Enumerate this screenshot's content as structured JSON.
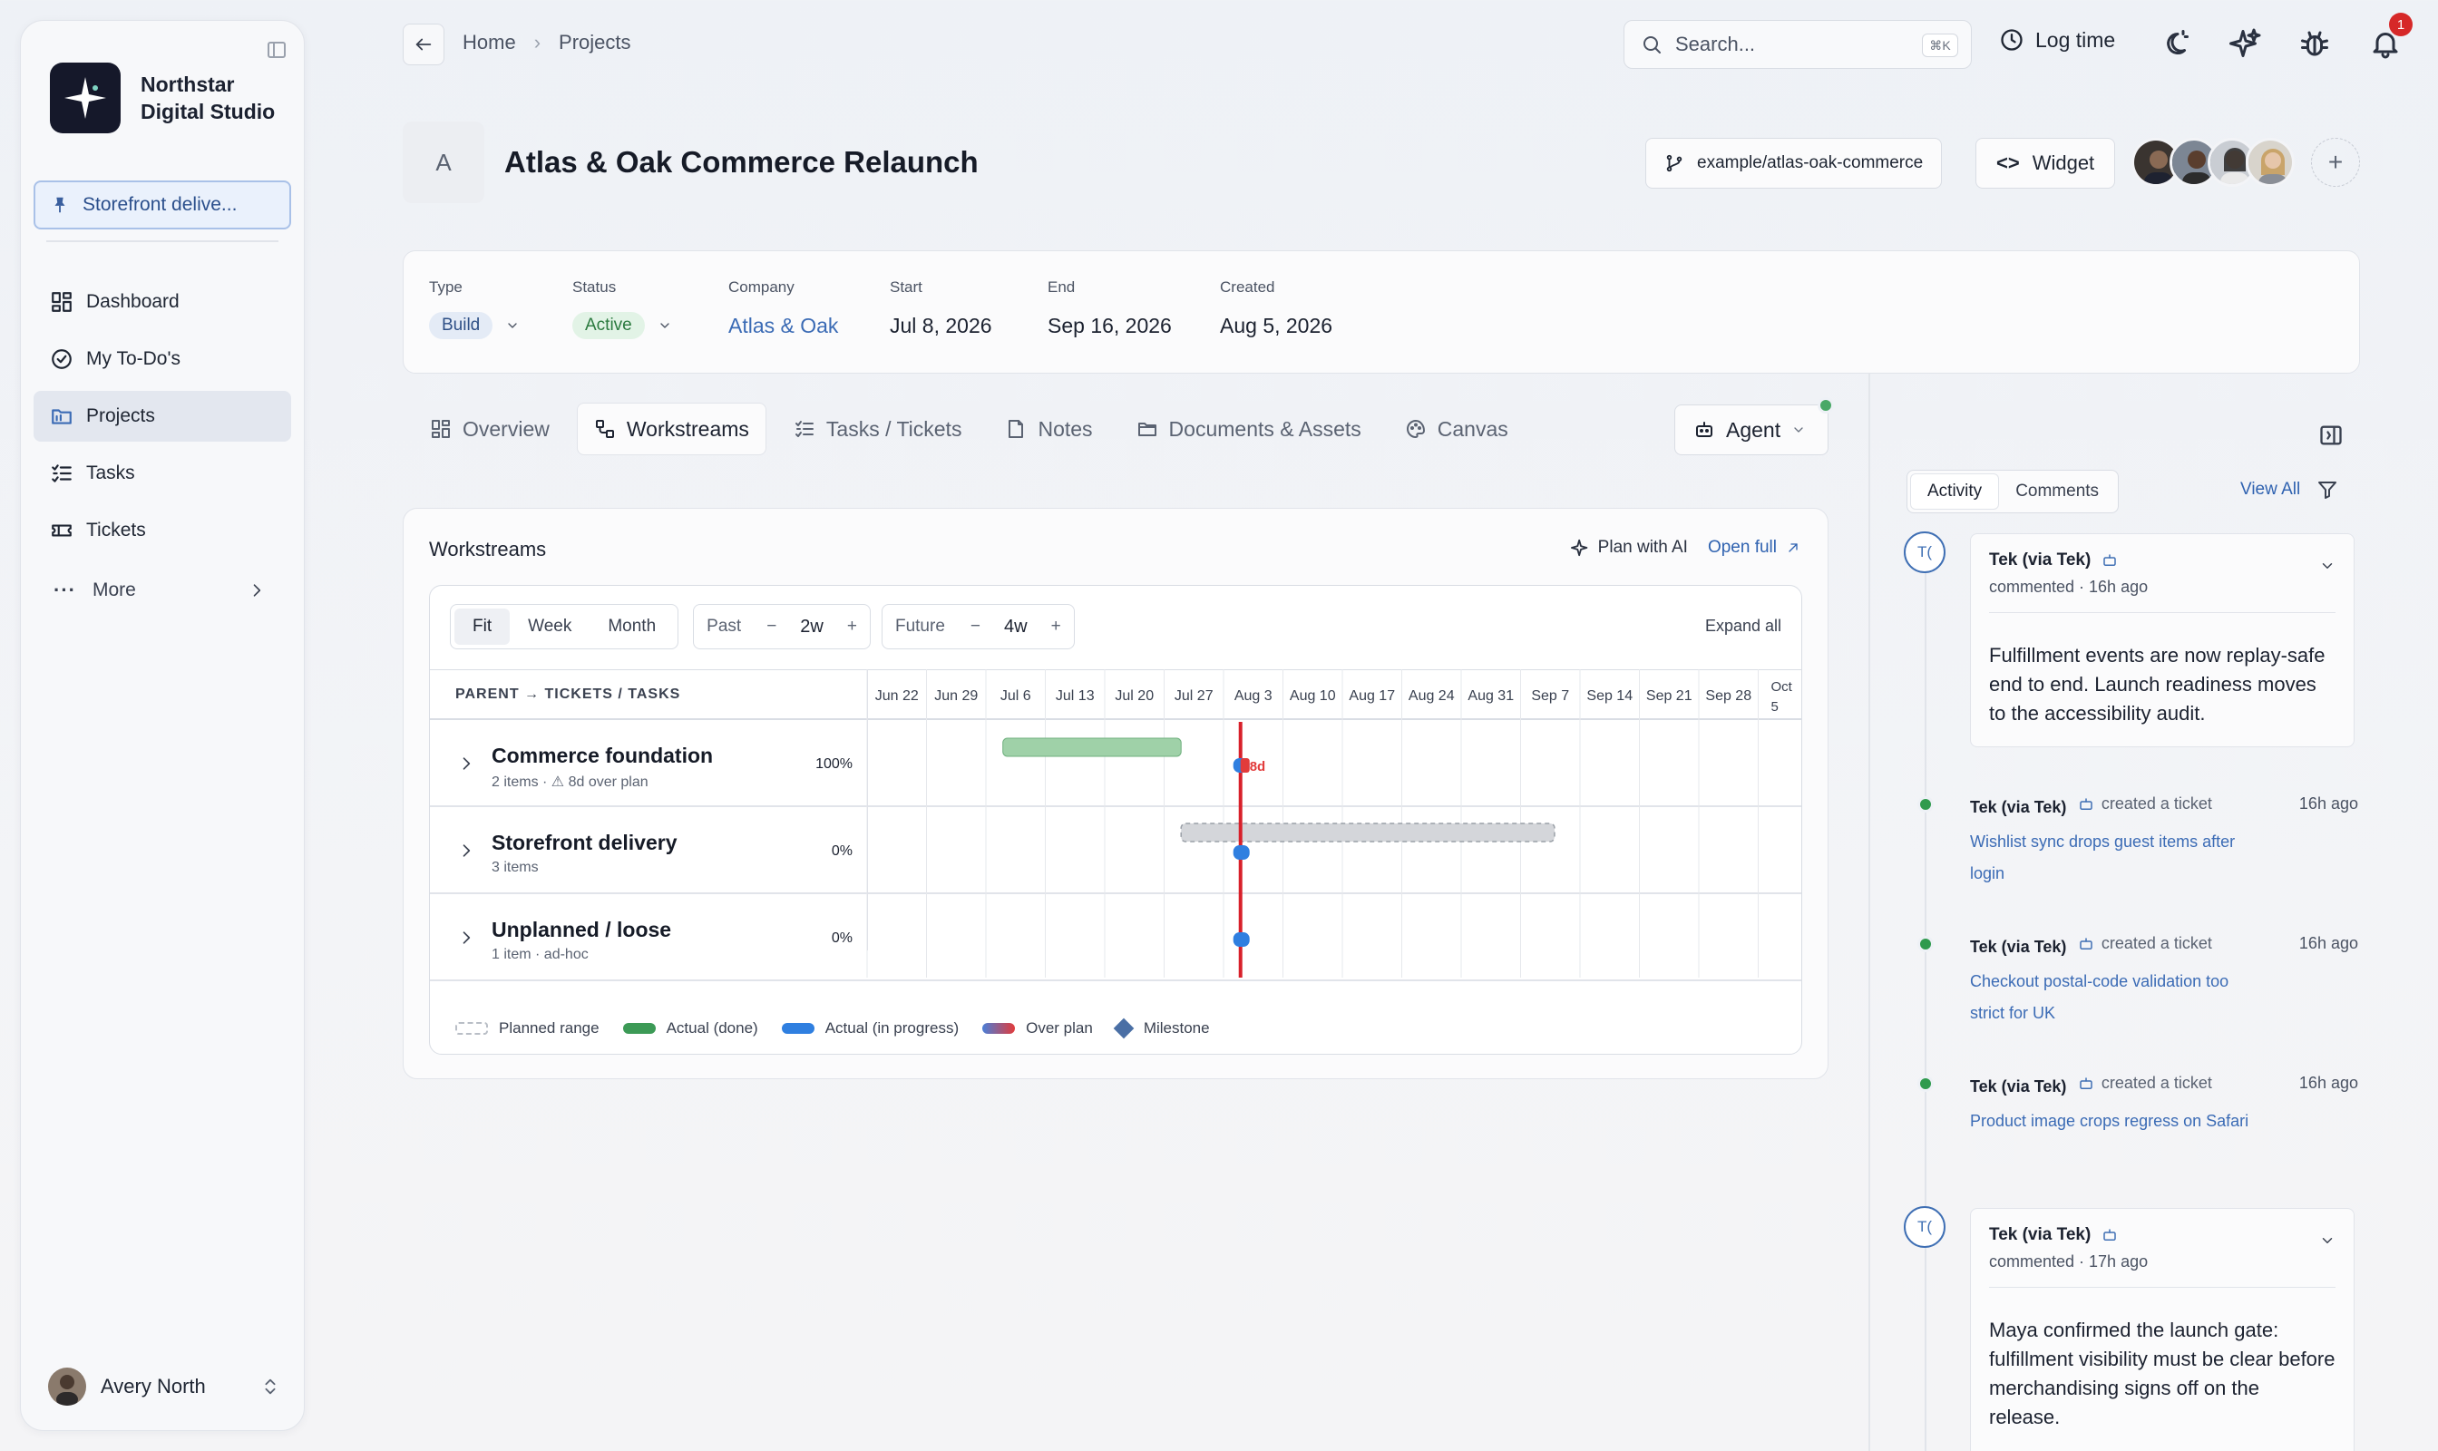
{
  "sidebar": {
    "org_name_line1": "Northstar",
    "org_name_line2": "Digital Studio",
    "pinned": "Storefront delive...",
    "nav": [
      {
        "label": "Dashboard",
        "icon": "dashboard-icon"
      },
      {
        "label": "My To-Do's",
        "icon": "check-circle-icon"
      },
      {
        "label": "Projects",
        "icon": "folder-icon",
        "active": true
      },
      {
        "label": "Tasks",
        "icon": "task-list-icon"
      },
      {
        "label": "Tickets",
        "icon": "ticket-icon"
      }
    ],
    "more": "More",
    "user": "Avery North"
  },
  "topbar": {
    "breadcrumb": [
      "Home",
      "Projects"
    ],
    "search_placeholder": "Search...",
    "shortcut": "⌘K",
    "log_time": "Log time",
    "notification_count": "1"
  },
  "project": {
    "avatar_letter": "A",
    "title": "Atlas & Oak Commerce Relaunch",
    "repo": "example/atlas-oak-commerce",
    "widget": "Widget",
    "meta": {
      "type_label": "Type",
      "type": "Build",
      "status_label": "Status",
      "status": "Active",
      "company_label": "Company",
      "company": "Atlas & Oak",
      "start_label": "Start",
      "start": "Jul 8, 2026",
      "end_label": "End",
      "end": "Sep 16, 2026",
      "created_label": "Created",
      "created": "Aug 5, 2026"
    }
  },
  "tabs": [
    "Overview",
    "Workstreams",
    "Tasks / Tickets",
    "Notes",
    "Documents & Assets",
    "Canvas"
  ],
  "active_tab": "Workstreams",
  "agent": "Agent",
  "workstreams": {
    "title": "Workstreams",
    "plan_ai": "Plan with AI",
    "open_full": "Open full",
    "zoom": [
      "Fit",
      "Week",
      "Month"
    ],
    "past_label": "Past",
    "past_value": "2w",
    "future_label": "Future",
    "future_value": "4w",
    "expand_all": "Expand all",
    "column_header": "PARENT → TICKETS / TASKS",
    "weeks": [
      "Jun 22",
      "Jun 29",
      "Jul 6",
      "Jul 13",
      "Jul 20",
      "Jul 27",
      "Aug 3",
      "Aug 10",
      "Aug 17",
      "Aug 24",
      "Aug 31",
      "Sep 7",
      "Sep 14",
      "Sep 21",
      "Sep 28"
    ],
    "last_week_line1": "Oct",
    "last_week_line2": "5",
    "today_marker": "Aug 5",
    "rows": [
      {
        "name": "Commerce foundation",
        "sub": "2 items · ⚠ 8d over plan",
        "pct": "100%",
        "actual_done": {
          "start": "Jul 8",
          "end": "Jul 29"
        },
        "over_label": "8d"
      },
      {
        "name": "Storefront delivery",
        "sub": "3 items",
        "pct": "0%",
        "planned": {
          "start": "Jul 29",
          "end": "Sep 11"
        }
      },
      {
        "name": "Unplanned / loose",
        "sub": "1 item · ad-hoc",
        "pct": "0%"
      }
    ],
    "legend": [
      "Planned range",
      "Actual (done)",
      "Actual (in progress)",
      "Over plan",
      "Milestone"
    ]
  },
  "activity": {
    "tabs": [
      "Activity",
      "Comments"
    ],
    "view_all": "View All",
    "items": [
      {
        "kind": "comment",
        "avatar": "T(",
        "who": "Tek (via Tek)",
        "when": "commented · 16h ago",
        "body": "Fulfillment events are now replay-safe end to end. Launch readiness moves to the accessibility audit."
      },
      {
        "kind": "event",
        "who": "Tek (via Tek)",
        "action": "created a ticket",
        "time": "16h ago",
        "link": "Wishlist sync drops guest items after login"
      },
      {
        "kind": "event",
        "who": "Tek (via Tek)",
        "action": "created a ticket",
        "time": "16h ago",
        "link": "Checkout postal-code validation too strict for UK"
      },
      {
        "kind": "event",
        "who": "Tek (via Tek)",
        "action": "created a ticket",
        "time": "16h ago",
        "link": "Product image crops regress on Safari"
      },
      {
        "kind": "comment",
        "avatar": "T(",
        "who": "Tek (via Tek)",
        "when": "commented · 17h ago",
        "body": "Maya confirmed the launch gate: fulfillment visibility must be clear before merchandising signs off on the release."
      }
    ]
  },
  "colors": {
    "planned": "#d4d6da",
    "done": "#9fd1a8",
    "progress": "#2f7fe0",
    "over": "#e23b3b",
    "milestone": "#4a6fa5",
    "today": "#d8202a"
  }
}
